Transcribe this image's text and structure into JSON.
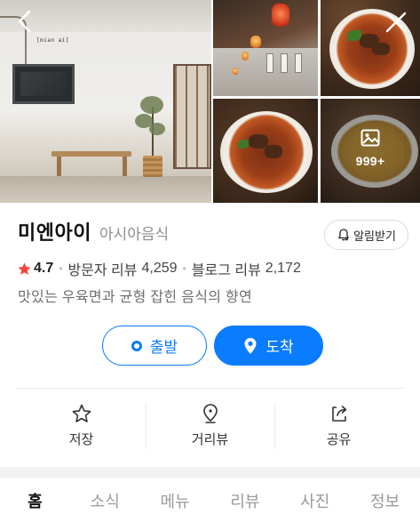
{
  "gallery": {
    "shop_sign_text": "[mian ai]",
    "more_count": "999+"
  },
  "place": {
    "name": "미엔아이",
    "category": "아시아음식",
    "notify_label": "알림받기",
    "rating": "4.7",
    "visitor_review_label": "방문자 리뷰",
    "visitor_review_count": "4,259",
    "blog_review_label": "블로그 리뷰",
    "blog_review_count": "2,172",
    "description": "맛있는 우육면과 균형 잡힌 음식의 향연"
  },
  "route": {
    "depart_label": "출발",
    "arrive_label": "도착"
  },
  "actions": {
    "save_label": "저장",
    "street_view_label": "거리뷰",
    "share_label": "공유"
  },
  "tabs": [
    {
      "label": "홈",
      "active": true
    },
    {
      "label": "소식",
      "active": false
    },
    {
      "label": "메뉴",
      "active": false
    },
    {
      "label": "리뷰",
      "active": false
    },
    {
      "label": "사진",
      "active": false
    },
    {
      "label": "정보",
      "active": false
    }
  ],
  "colors": {
    "accent": "#0a7cff",
    "star": "#f4463c",
    "text_primary": "#111111",
    "text_secondary": "#8e8e8e"
  }
}
